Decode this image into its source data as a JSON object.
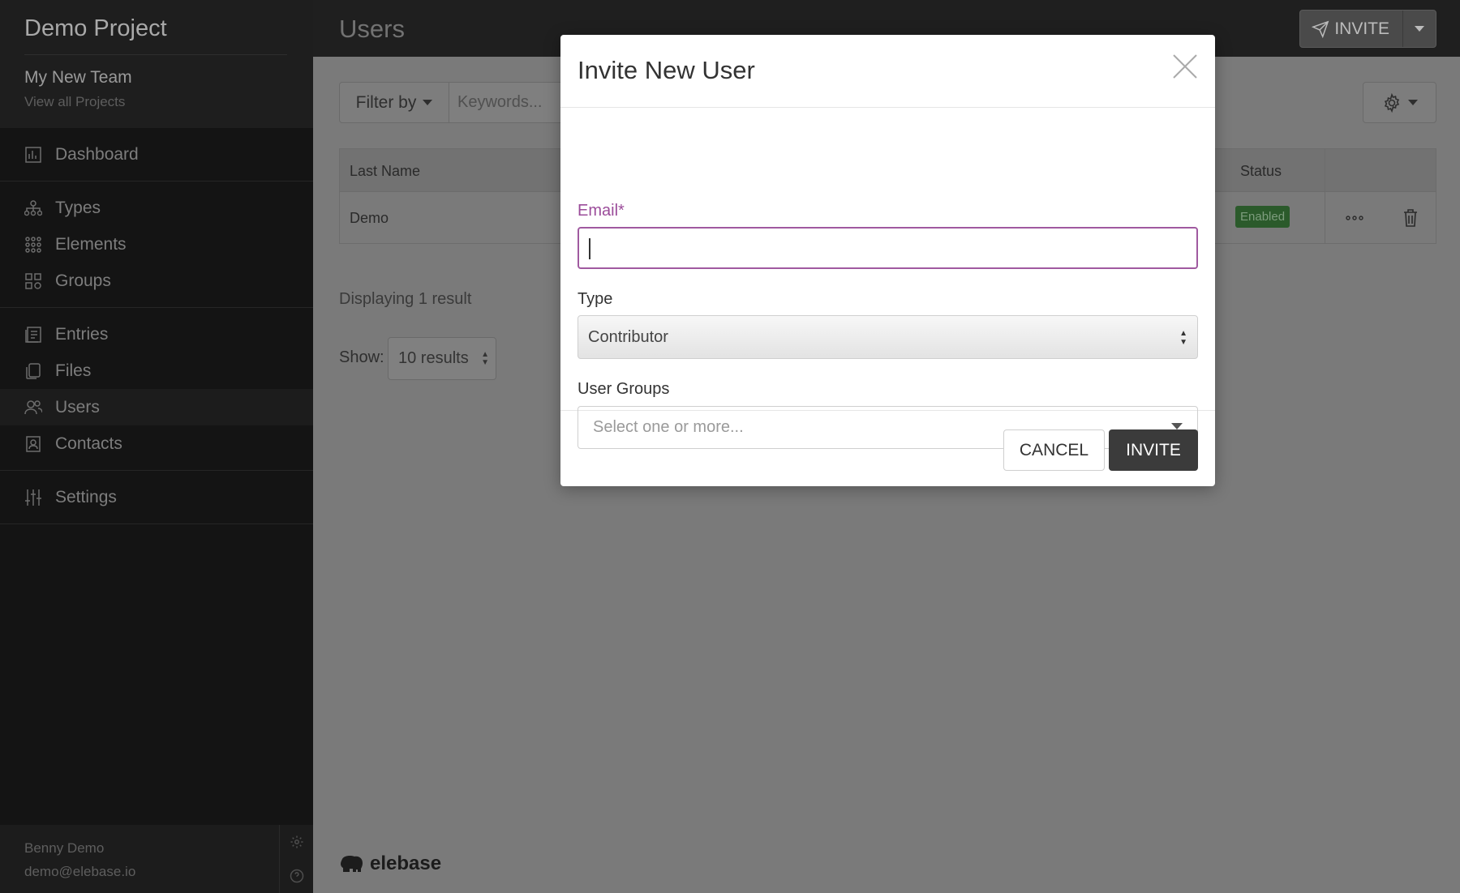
{
  "sidebar": {
    "project_name": "Demo Project",
    "team_name": "My New Team",
    "view_all": "View all Projects",
    "groups": [
      [
        {
          "label": "Dashboard",
          "icon": "dashboard-icon"
        }
      ],
      [
        {
          "label": "Types",
          "icon": "types-icon"
        },
        {
          "label": "Elements",
          "icon": "elements-icon"
        },
        {
          "label": "Groups",
          "icon": "groups-icon"
        }
      ],
      [
        {
          "label": "Entries",
          "icon": "entries-icon"
        },
        {
          "label": "Files",
          "icon": "files-icon"
        },
        {
          "label": "Users",
          "icon": "users-icon",
          "active": true
        },
        {
          "label": "Contacts",
          "icon": "contacts-icon"
        }
      ],
      [
        {
          "label": "Settings",
          "icon": "settings-sliders-icon"
        }
      ]
    ],
    "footer": {
      "user_name": "Benny Demo",
      "user_email": "demo@elebase.io"
    }
  },
  "header": {
    "title": "Users",
    "invite_label": "INVITE"
  },
  "filter": {
    "label": "Filter by",
    "keywords_placeholder": "Keywords..."
  },
  "table": {
    "headers": {
      "last_name": "Last Name",
      "status": "Status"
    },
    "rows": [
      {
        "last_name": "Demo",
        "status": "Enabled"
      }
    ]
  },
  "results": {
    "count_text": "Displaying 1 result",
    "show_label": "Show:",
    "show_value": "10 results"
  },
  "brand": {
    "name": "elebase"
  },
  "modal": {
    "title": "Invite New User",
    "email_label": "Email*",
    "email_value": "",
    "type_label": "Type",
    "type_value": "Contributor",
    "groups_label": "User Groups",
    "groups_placeholder": "Select one or more...",
    "cancel_label": "CANCEL",
    "invite_label": "INVITE"
  },
  "colors": {
    "accent_purple": "#9b4c9a",
    "status_enabled": "#2b5a2b",
    "primary_button": "#3b3b3b"
  }
}
